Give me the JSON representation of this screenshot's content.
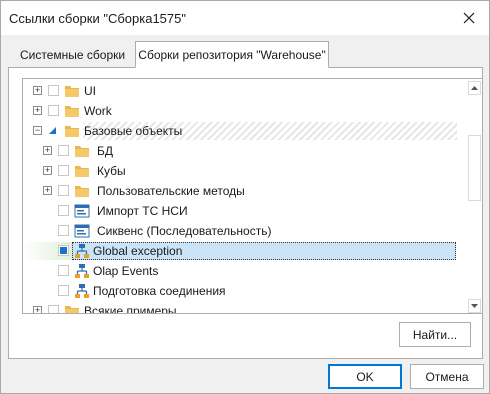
{
  "window": {
    "title": "Ссылки сборки \"Сборка1575\""
  },
  "tabs": [
    {
      "label": "Системные сборки"
    },
    {
      "label": "Сборки репозитория \"Warehouse\""
    }
  ],
  "tree": {
    "items": [
      {
        "label": "UI",
        "icon": "folder-icon",
        "expander": "+"
      },
      {
        "label": "Work",
        "icon": "folder-icon",
        "expander": "+"
      },
      {
        "label": "Базовые объекты",
        "icon": "folder-icon",
        "expander": "−"
      },
      {
        "label": "БД",
        "icon": "folder-icon",
        "expander": "+"
      },
      {
        "label": "Кубы",
        "icon": "folder-icon",
        "expander": "+"
      },
      {
        "label": "Пользовательские методы",
        "icon": "folder-icon",
        "expander": "+"
      },
      {
        "label": "Импорт ТС НСИ",
        "icon": "form-icon"
      },
      {
        "label": "Сиквенс (Последовательность)",
        "icon": "form-icon"
      },
      {
        "label": "Global exception",
        "icon": "assembly-icon"
      },
      {
        "label": "Olap Events",
        "icon": "assembly-icon"
      },
      {
        "label": "Подготовка соединения",
        "icon": "assembly-icon"
      },
      {
        "label": "Всякие примеры",
        "icon": "folder-icon",
        "expander": "+"
      }
    ]
  },
  "buttons": {
    "find": "Найти...",
    "ok": "OK",
    "cancel": "Отмена"
  },
  "colors": {
    "folder": "#e8b84a",
    "selection": "#cce4f7",
    "accent": "#0078d7"
  }
}
